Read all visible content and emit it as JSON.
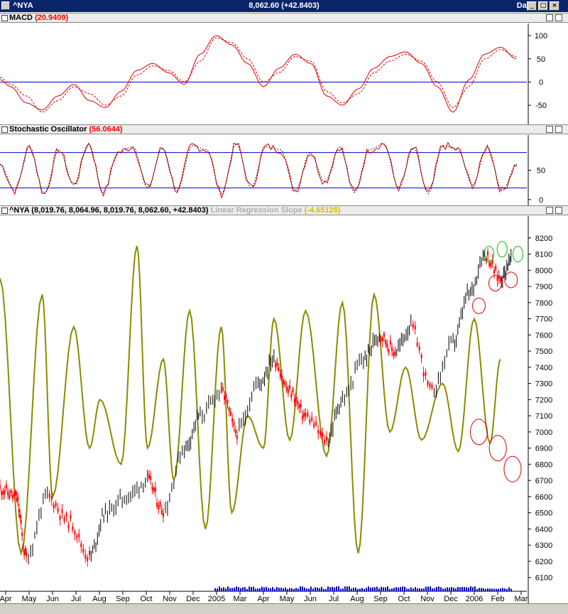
{
  "window": {
    "symbol": "^NYA",
    "price_change": "8,062.60 (+42.8403)",
    "period": "Daily",
    "controls": [
      "_",
      "□",
      "×"
    ]
  },
  "panes": {
    "macd": {
      "label": "MACD",
      "value": "(20.9409)"
    },
    "stochastic": {
      "label": "Stochastic Oscillator",
      "value": "(56.0644)"
    },
    "main": {
      "label": "^NYA",
      "ohlc": "(8,019.76, 8,064.96, 8,019.76, 8,062.60, +42.8403)",
      "indicator_label": "Linear Regression Slope",
      "indicator_value": "(-4.65128)"
    }
  },
  "colors": {
    "price_up": "#000000",
    "price_down": "#ff0000",
    "slope": "#8b8b00",
    "macd": "#e00000",
    "reference_line": "#0000cc",
    "volume": "#0000c0",
    "circle_red": "#e00000",
    "circle_green": "#00c000"
  },
  "chart_data": [
    {
      "type": "line",
      "name": "MACD",
      "ylim": [
        -85,
        120
      ],
      "yticks": [
        100,
        50,
        0,
        -50
      ],
      "reference_line": 0,
      "x": [
        0,
        0.02,
        0.05,
        0.08,
        0.11,
        0.14,
        0.17,
        0.2,
        0.23,
        0.26,
        0.29,
        0.32,
        0.35,
        0.38,
        0.41,
        0.44,
        0.47,
        0.5,
        0.53,
        0.56,
        0.59,
        0.62,
        0.65,
        0.68,
        0.71,
        0.74,
        0.77,
        0.8,
        0.83,
        0.86,
        0.89,
        0.92,
        0.95,
        0.98
      ],
      "series": [
        {
          "line": "solid",
          "values": [
            5,
            -10,
            -45,
            -60,
            -30,
            -5,
            -40,
            -55,
            -20,
            25,
            40,
            20,
            -5,
            60,
            100,
            80,
            40,
            -10,
            30,
            60,
            40,
            -30,
            -50,
            -15,
            30,
            55,
            65,
            40,
            -10,
            -65,
            5,
            60,
            75,
            50
          ]
        },
        {
          "line": "dashed",
          "values": [
            10,
            -5,
            -30,
            -65,
            -40,
            -10,
            -25,
            -50,
            -30,
            15,
            35,
            25,
            0,
            45,
            95,
            85,
            50,
            0,
            20,
            55,
            45,
            -20,
            -45,
            -25,
            20,
            45,
            60,
            45,
            0,
            -55,
            -10,
            50,
            70,
            55
          ]
        }
      ]
    },
    {
      "type": "line",
      "name": "Stochastic Oscillator",
      "ylim": [
        -5,
        105
      ],
      "yticks": [
        50,
        0
      ],
      "reference_lines": [
        80,
        20
      ],
      "series": [
        {
          "values": [
            60,
            15,
            90,
            10,
            85,
            25,
            95,
            12,
            80,
            90,
            20,
            88,
            15,
            92,
            85,
            10,
            95,
            20,
            90,
            85,
            15,
            80,
            30,
            90,
            12,
            85,
            95,
            20,
            88,
            10,
            92,
            85,
            25,
            90,
            15,
            60
          ]
        }
      ]
    },
    {
      "type": "bar",
      "name": "^NYA",
      "ylim": [
        6050,
        8300
      ],
      "yticks": [
        8200,
        8100,
        8000,
        7900,
        7800,
        7700,
        7600,
        7500,
        7400,
        7300,
        7200,
        7100,
        7000,
        6900,
        6800,
        6700,
        6600,
        6500,
        6400,
        6300,
        6200,
        6100
      ],
      "xticks": [
        "Apr",
        "May",
        "Jun",
        "Jul",
        "Aug",
        "Sep",
        "Oct",
        "Nov",
        "Dec",
        "2005",
        "Mar",
        "Apr",
        "May",
        "Jun",
        "Jul",
        "Aug",
        "Sep",
        "Oct",
        "Nov",
        "Dec",
        "2006",
        "Feb",
        "Mar"
      ],
      "price_x": [
        0,
        0.03,
        0.05,
        0.09,
        0.13,
        0.17,
        0.2,
        0.24,
        0.28,
        0.31,
        0.35,
        0.38,
        0.42,
        0.45,
        0.49,
        0.52,
        0.55,
        0.58,
        0.62,
        0.65,
        0.69,
        0.72,
        0.75,
        0.78,
        0.82,
        0.86,
        0.89,
        0.92,
        0.95,
        0.97
      ],
      "price": [
        6650,
        6600,
        6230,
        6600,
        6450,
        6230,
        6500,
        6600,
        6700,
        6520,
        6900,
        7100,
        7250,
        7000,
        7300,
        7450,
        7250,
        7100,
        6950,
        7200,
        7450,
        7600,
        7500,
        7650,
        7250,
        7550,
        7850,
        8100,
        7950,
        8060
      ],
      "slope_x": [
        0,
        0.04,
        0.08,
        0.1,
        0.14,
        0.17,
        0.19,
        0.23,
        0.26,
        0.28,
        0.31,
        0.33,
        0.36,
        0.39,
        0.42,
        0.44,
        0.47,
        0.5,
        0.52,
        0.55,
        0.58,
        0.62,
        0.65,
        0.68,
        0.71,
        0.74,
        0.77,
        0.8,
        0.84,
        0.87,
        0.9,
        0.93,
        0.95
      ],
      "slope": [
        7950,
        6250,
        7850,
        6600,
        7650,
        6900,
        7200,
        6800,
        8150,
        6900,
        7450,
        6700,
        7750,
        6400,
        7650,
        6500,
        7100,
        6900,
        7700,
        6950,
        7750,
        6850,
        7800,
        6250,
        7850,
        7000,
        7400,
        6950,
        7300,
        6880,
        7700,
        6930,
        7450
      ],
      "annotations_red": [
        7780,
        7000,
        6900,
        6770,
        7920,
        7940
      ],
      "annotations_green": [
        8100,
        8130,
        8100
      ]
    }
  ]
}
